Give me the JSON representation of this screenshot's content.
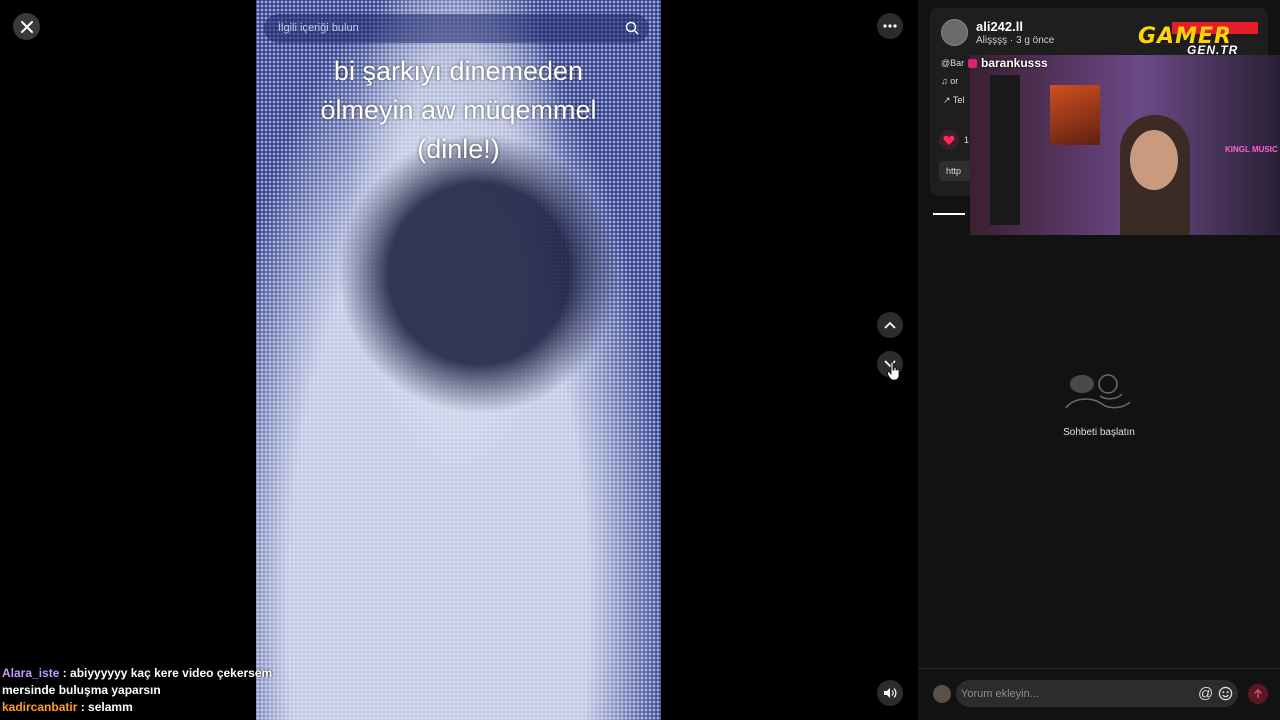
{
  "player": {
    "search_placeholder": "İlgili içeriği bulun",
    "caption_lines": [
      "bi şarkıyı dinemeden",
      "ölmeyin aw müqemmel",
      "(dinle!)"
    ]
  },
  "chat": [
    {
      "user": "Alara_iste",
      "sep": " : ",
      "text": "abiyyyyyy kaç kere video çekersem mersinde buluşma yaparsın"
    },
    {
      "user": "kadircanbatir",
      "sep": " : ",
      "text": "selamm"
    }
  ],
  "post": {
    "username": "ali242.ll",
    "subtitle": "Alişşşş · 3 g önce",
    "desc_mention": "@Bar",
    "desc_music": "♫ or",
    "desc_tag": "↗ Tel",
    "like_count": "1",
    "link_label": "http"
  },
  "stream": {
    "streamer_name": "barankusss",
    "logo_top": "GAMER",
    "logo_bottom": "GEN.TR",
    "neon_sign": "KINGL MUSIC"
  },
  "comments": {
    "empty_text": "Sohbeti başlatın",
    "input_placeholder": "Yorum ekleyin...",
    "at_symbol": "@"
  },
  "colors": {
    "accent_red": "#fe2c55",
    "video_blue": "#2a3a8c"
  }
}
